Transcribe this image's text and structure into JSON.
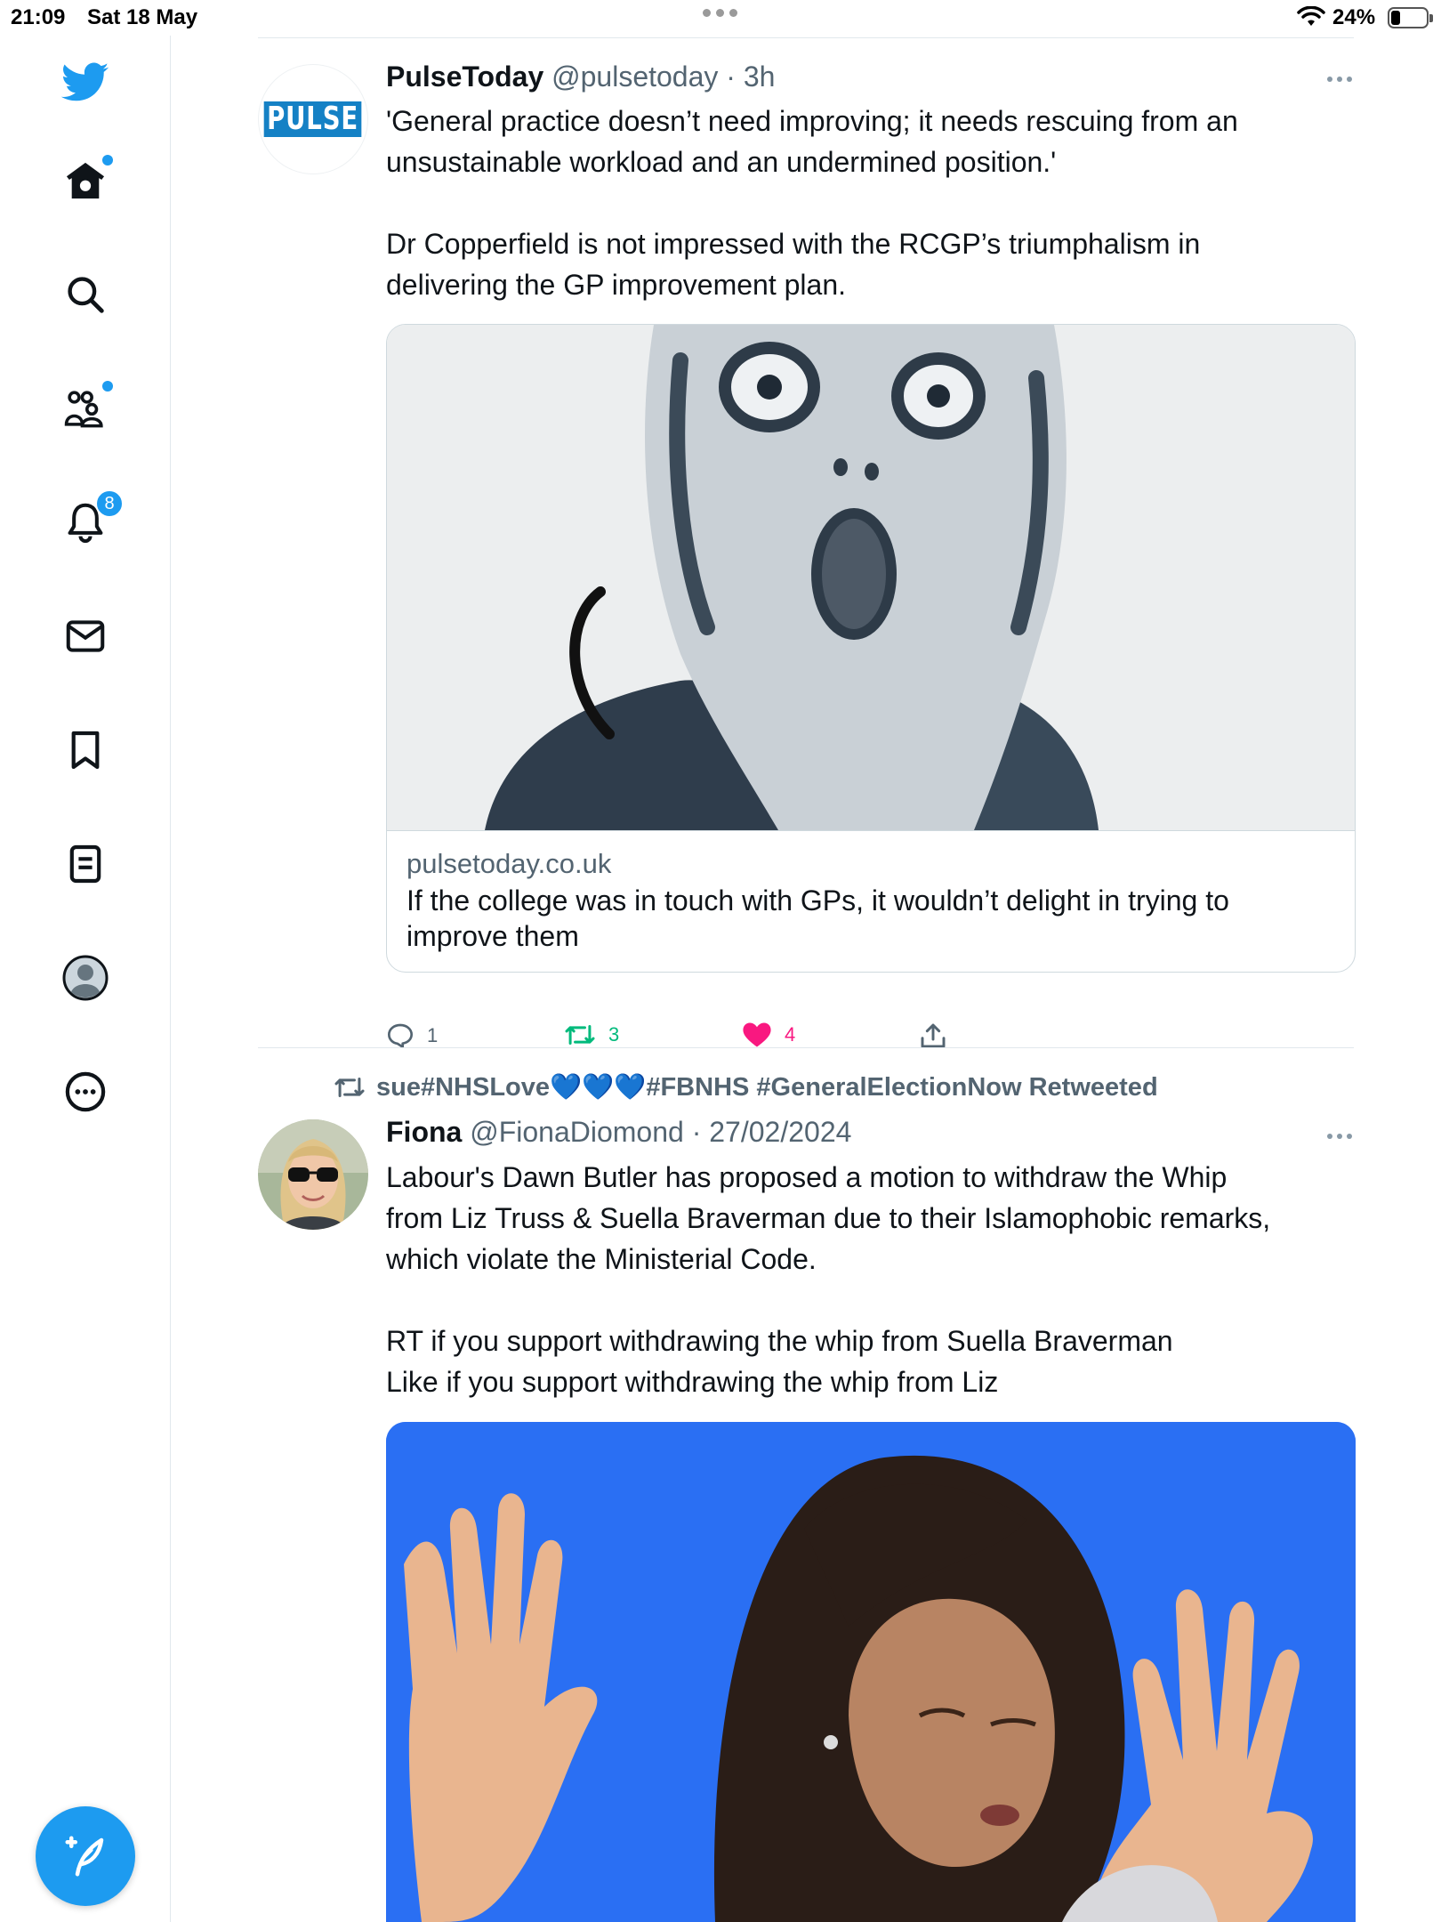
{
  "status_bar": {
    "time": "21:09",
    "date": "Sat 18 May",
    "battery_percent": "24%",
    "battery_level": 0.24
  },
  "sidebar": {
    "items": [
      {
        "name": "twitter-logo",
        "icon": "twitter-bird-icon"
      },
      {
        "name": "home",
        "icon": "home-icon",
        "has_dot": true
      },
      {
        "name": "explore",
        "icon": "search-icon"
      },
      {
        "name": "communities",
        "icon": "communities-icon",
        "has_dot": true
      },
      {
        "name": "notifications",
        "icon": "bell-icon",
        "badge": "8"
      },
      {
        "name": "messages",
        "icon": "mail-icon"
      },
      {
        "name": "bookmarks",
        "icon": "bookmark-icon"
      },
      {
        "name": "lists",
        "icon": "list-icon"
      },
      {
        "name": "profile",
        "icon": "avatar-icon"
      },
      {
        "name": "more",
        "icon": "more-circle-icon"
      }
    ],
    "compose_icon": "compose-feather-icon"
  },
  "tweets": [
    {
      "author_name": "PulseToday",
      "handle_time": "@pulsetoday · 3h",
      "avatar_text": "PULSE",
      "text": [
        "'General practice doesn’t need improving; it needs rescuing from an",
        "unsustainable workload and an undermined position.'",
        "",
        "Dr Copperfield is not impressed with the RCGP’s triumphalism in",
        "delivering the GP improvement plan."
      ],
      "card": {
        "domain": "pulsetoday.co.uk",
        "title_line1": "If the college was in touch with GPs, it wouldn’t delight in trying to",
        "title_line2": "improve them"
      },
      "actions": {
        "replies": "1",
        "retweets": "3",
        "likes": "4"
      }
    },
    {
      "retweeted_by": "sue#NHSLove💙💙💙#FBNHS #GeneralElectionNow Retweeted",
      "author_name": "Fiona",
      "handle_time": "@FionaDiomond · 27/02/2024",
      "text": [
        "Labour's Dawn Butler has proposed a motion to withdraw the Whip",
        "from Liz Truss & Suella Braverman due to their Islamophobic remarks,",
        "which violate the Ministerial Code.",
        "",
        "RT if you support withdrawing the whip from Suella Braverman",
        "Like if you support withdrawing the whip from Liz"
      ]
    }
  ],
  "colors": {
    "accent": "#1d9bf0",
    "retweet": "#00ba7c",
    "like": "#f91880",
    "secondary_text": "#536471"
  }
}
